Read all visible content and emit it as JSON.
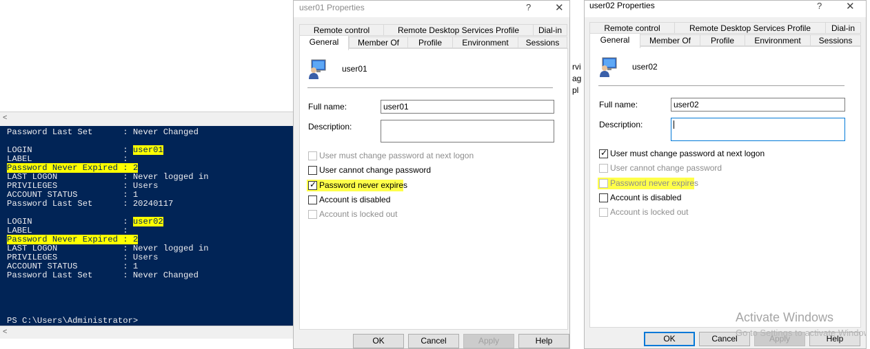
{
  "console": {
    "lines": [
      {
        "text": "Password Last Set      : Never Changed"
      },
      {
        "text": ""
      },
      {
        "text": "LOGIN                  : ",
        "value": "user01",
        "value_hl": true
      },
      {
        "text": "LABEL                  :"
      },
      {
        "text": "Password Never Expired : 2",
        "hl": true
      },
      {
        "text": "LAST LOGON             : Never logged in"
      },
      {
        "text": "PRIVILEGES             : Users"
      },
      {
        "text": "ACCOUNT STATUS         : 1"
      },
      {
        "text": "Password Last Set      : 20240117"
      },
      {
        "text": ""
      },
      {
        "text": "LOGIN                  : ",
        "value": "user02",
        "value_hl": true
      },
      {
        "text": "LABEL                  :"
      },
      {
        "text": "Password Never Expired : 2",
        "hl": true
      },
      {
        "text": "LAST LOGON             : Never logged in"
      },
      {
        "text": "PRIVILEGES             : Users"
      },
      {
        "text": "ACCOUNT STATUS         : 1"
      },
      {
        "text": "Password Last Set      : Never Changed"
      }
    ],
    "prompt": "PS C:\\Users\\Administrator>",
    "scroll_arrow": "<"
  },
  "strip_fragments": [
    "rvi",
    "ag",
    "pl"
  ],
  "dialogs": [
    {
      "id": "user01",
      "title": "user01 Properties",
      "help_glyph": "?",
      "close_glyph": "✕",
      "tabs_row1": [
        "Remote control",
        "Remote Desktop Services Profile",
        "Dial-in"
      ],
      "tabs_row2": [
        "General",
        "Member Of",
        "Profile",
        "Environment",
        "Sessions"
      ],
      "selected_tab": "General",
      "username": "user01",
      "full_name_label": "Full name:",
      "full_name_value": "user01",
      "description_label": "Description:",
      "description_value": "",
      "checkboxes": [
        {
          "label": "User must change password at next logon",
          "checked": false,
          "disabled": true,
          "highlight": false
        },
        {
          "label": "User cannot change password",
          "checked": false,
          "disabled": false,
          "highlight": false
        },
        {
          "label": "Password never expires",
          "checked": true,
          "disabled": false,
          "highlight": true
        },
        {
          "label": "Account is disabled",
          "checked": false,
          "disabled": false,
          "highlight": false
        },
        {
          "label": "Account is locked out",
          "checked": false,
          "disabled": true,
          "highlight": false
        }
      ],
      "buttons": {
        "ok": "OK",
        "cancel": "Cancel",
        "apply": "Apply",
        "help": "Help"
      }
    },
    {
      "id": "user02",
      "title": "user02 Properties",
      "help_glyph": "?",
      "close_glyph": "✕",
      "tabs_row1": [
        "Remote control",
        "Remote Desktop Services Profile",
        "Dial-in"
      ],
      "tabs_row2": [
        "General",
        "Member Of",
        "Profile",
        "Environment",
        "Sessions"
      ],
      "selected_tab": "General",
      "username": "user02",
      "full_name_label": "Full name:",
      "full_name_value": "user02",
      "description_label": "Description:",
      "description_value": "",
      "checkboxes": [
        {
          "label": "User must change password at next logon",
          "checked": true,
          "disabled": false,
          "highlight": false
        },
        {
          "label": "User cannot change password",
          "checked": false,
          "disabled": true,
          "highlight": false
        },
        {
          "label": "Password never expires",
          "checked": false,
          "disabled": true,
          "highlight": true
        },
        {
          "label": "Account is disabled",
          "checked": false,
          "disabled": false,
          "highlight": false
        },
        {
          "label": "Account is locked out",
          "checked": false,
          "disabled": true,
          "highlight": false
        }
      ],
      "buttons": {
        "ok": "OK",
        "cancel": "Cancel",
        "apply": "Apply",
        "help": "Help"
      }
    }
  ],
  "watermark": {
    "title": "Activate Windows",
    "subtitle": "Go to Settings to activate Windows."
  }
}
